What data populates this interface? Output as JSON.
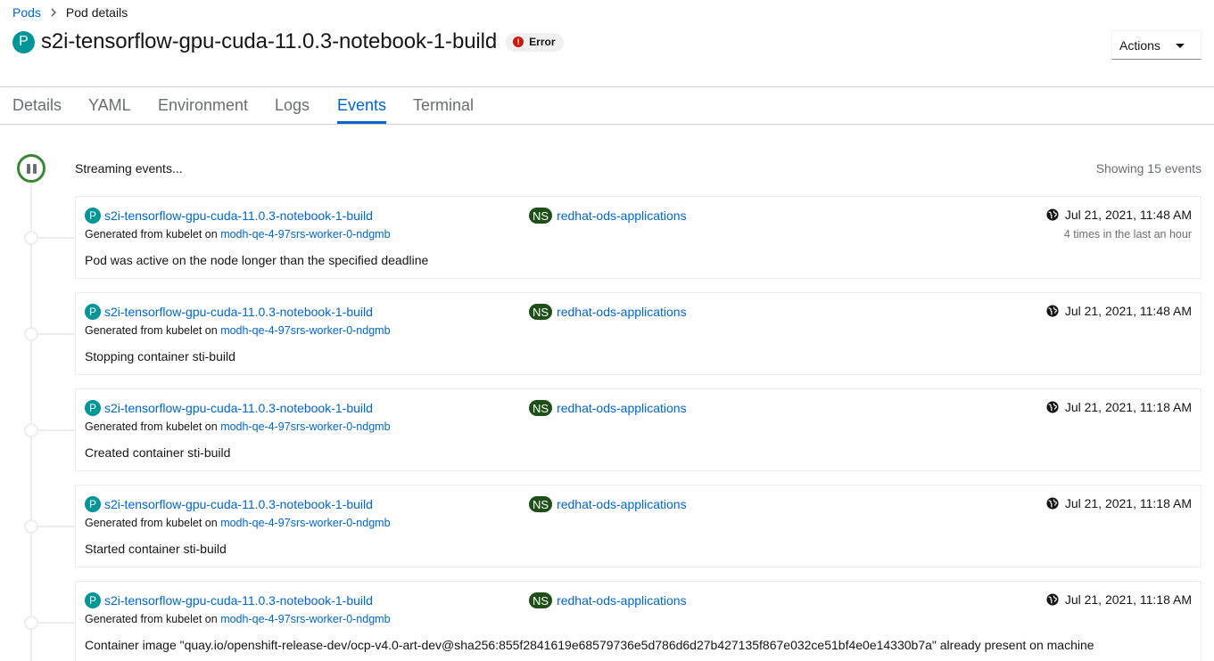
{
  "breadcrumb": {
    "parent": "Pods",
    "current": "Pod details"
  },
  "header": {
    "resource_badge": "P",
    "title": "s2i-tensorflow-gpu-cuda-11.0.3-notebook-1-build",
    "status": "Error",
    "status_icon": "exclamation-circle-icon",
    "actions_label": "Actions"
  },
  "tabs": [
    {
      "label": "Details"
    },
    {
      "label": "YAML"
    },
    {
      "label": "Environment"
    },
    {
      "label": "Logs"
    },
    {
      "label": "Events",
      "active": true
    },
    {
      "label": "Terminal"
    }
  ],
  "events_header": {
    "streaming": "Streaming events...",
    "count": "Showing 15 events"
  },
  "common": {
    "generated_prefix": "Generated from kubelet on",
    "ns_badge": "NS"
  },
  "events": [
    {
      "resource": "s2i-tensorflow-gpu-cuda-11.0.3-notebook-1-build",
      "node": "modh-qe-4-97srs-worker-0-ndgmb",
      "namespace": "redhat-ods-applications",
      "time": "Jul 21, 2021, 11:48 AM",
      "count": "4 times in the last an hour",
      "message": "Pod was active on the node longer than the specified deadline"
    },
    {
      "resource": "s2i-tensorflow-gpu-cuda-11.0.3-notebook-1-build",
      "node": "modh-qe-4-97srs-worker-0-ndgmb",
      "namespace": "redhat-ods-applications",
      "time": "Jul 21, 2021, 11:48 AM",
      "count": "",
      "message": "Stopping container sti-build"
    },
    {
      "resource": "s2i-tensorflow-gpu-cuda-11.0.3-notebook-1-build",
      "node": "modh-qe-4-97srs-worker-0-ndgmb",
      "namespace": "redhat-ods-applications",
      "time": "Jul 21, 2021, 11:18 AM",
      "count": "",
      "message": "Created container sti-build"
    },
    {
      "resource": "s2i-tensorflow-gpu-cuda-11.0.3-notebook-1-build",
      "node": "modh-qe-4-97srs-worker-0-ndgmb",
      "namespace": "redhat-ods-applications",
      "time": "Jul 21, 2021, 11:18 AM",
      "count": "",
      "message": "Started container sti-build"
    },
    {
      "resource": "s2i-tensorflow-gpu-cuda-11.0.3-notebook-1-build",
      "node": "modh-qe-4-97srs-worker-0-ndgmb",
      "namespace": "redhat-ods-applications",
      "time": "Jul 21, 2021, 11:18 AM",
      "count": "",
      "message": "Container image \"quay.io/openshift-release-dev/ocp-v4.0-art-dev@sha256:855f2841619e68579736e5d786d6d27b427135f867e032ce51bf4e0e14330b7a\" already present on machine"
    }
  ]
}
